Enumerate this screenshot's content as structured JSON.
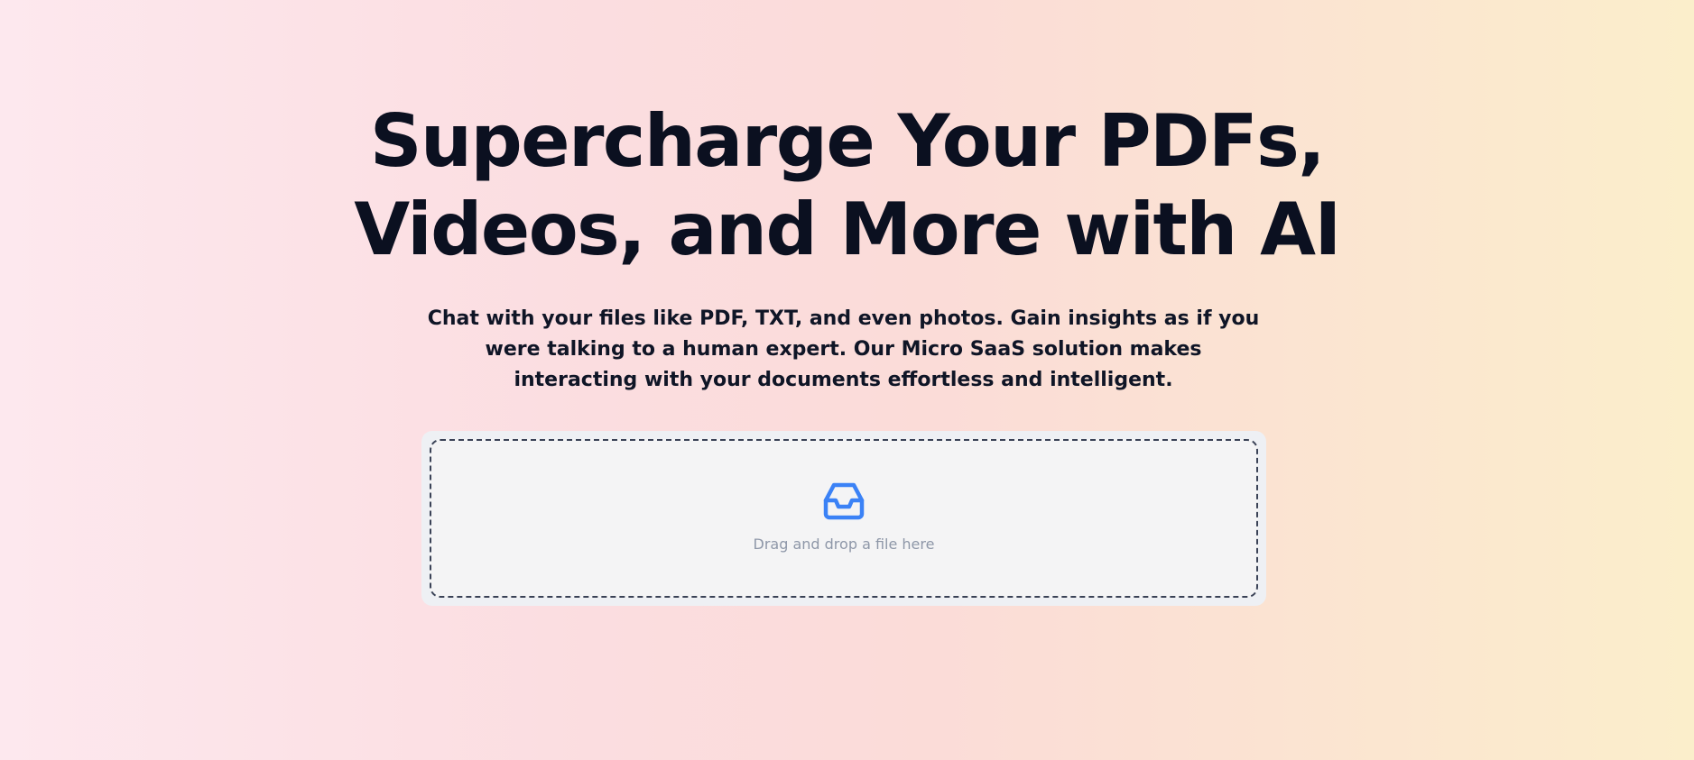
{
  "hero": {
    "headline_line1": "Supercharge Your PDFs,",
    "headline_line2": "Videos, and More with AI",
    "description": "Chat with your files like PDF, TXT, and even photos. Gain insights as if you were talking to a human expert. Our Micro SaaS solution makes interacting with your documents effortless and intelligent."
  },
  "upload": {
    "icon": "inbox-icon",
    "label": "Drag and drop a file here",
    "icon_color": "#3b82f6"
  },
  "colors": {
    "headline": "#0b1020",
    "drop_border": "#3a4256",
    "drop_background": "#f4f4f5",
    "label": "#8e97a8"
  }
}
